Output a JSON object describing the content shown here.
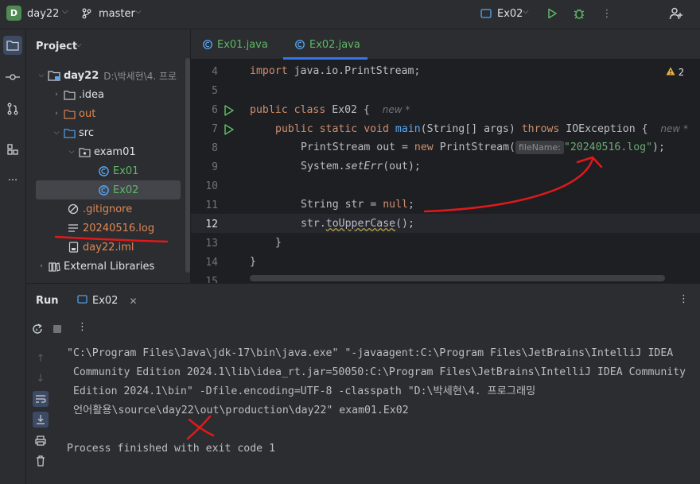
{
  "titlebar": {
    "project_badge": "D",
    "project_name": "day22",
    "branch": "master",
    "run_config": "Ex02"
  },
  "project_panel": {
    "title": "Project",
    "tree": [
      {
        "label": "day22",
        "suffix": "D:\\박세현\\4. 프로",
        "type": "module",
        "expanded": true
      },
      {
        "label": ".idea",
        "type": "folder",
        "expanded": false
      },
      {
        "label": "out",
        "type": "folder-excluded",
        "expanded": false
      },
      {
        "label": "src",
        "type": "folder-source",
        "expanded": true
      },
      {
        "label": "exam01",
        "type": "package",
        "expanded": true
      },
      {
        "label": "Ex01",
        "type": "class"
      },
      {
        "label": "Ex02",
        "type": "class",
        "selected": true
      },
      {
        "label": ".gitignore",
        "type": "ignore"
      },
      {
        "label": "20240516.log",
        "type": "text"
      },
      {
        "label": "day22.iml",
        "type": "iml"
      },
      {
        "label": "External Libraries",
        "type": "library",
        "expanded": false
      }
    ]
  },
  "editor": {
    "tabs": [
      {
        "label": "Ex01.java",
        "active": false
      },
      {
        "label": "Ex02.java",
        "active": true
      }
    ],
    "warnings": "2",
    "line_numbers": [
      "4",
      "5",
      "6",
      "7",
      "8",
      "9",
      "10",
      "11",
      "12",
      "13",
      "14",
      "15"
    ],
    "code": {
      "l4_kw": "import",
      "l4_rest": " java.io.PrintStream;",
      "l6_kw1": "public",
      "l6_kw2": "class",
      "l6_rest": " Ex02 {",
      "l6_hint": "new *",
      "l7_kw1": "public",
      "l7_kw2": "static",
      "l7_kw3": "void",
      "l7_fn": "main",
      "l7_rest1": "(String[] args) ",
      "l7_kw4": "throws",
      "l7_rest2": " IOException {",
      "l7_hint": "new *",
      "l8_a": "PrintStream out = ",
      "l8_kw": "new",
      "l8_b": " PrintStream(",
      "l8_param": "fileName:",
      "l8_str": "\"20240516.log\"",
      "l8_c": ");",
      "l9_a": "System.",
      "l9_st": "setErr",
      "l9_b": "(out);",
      "l11_a": "String str = ",
      "l11_kw": "null",
      "l11_b": ";",
      "l12_a": "str.",
      "l12_m": "toUpperCase",
      "l12_b": "();",
      "l13": "}",
      "l14": "}"
    }
  },
  "run_panel": {
    "title": "Run",
    "tab_label": "Ex02",
    "console": [
      "\"C:\\Program Files\\Java\\jdk-17\\bin\\java.exe\" \"-javaagent:C:\\Program Files\\JetBrains\\IntelliJ IDEA",
      " Community Edition 2024.1\\lib\\idea_rt.jar=50050:C:\\Program Files\\JetBrains\\IntelliJ IDEA Community",
      " Edition 2024.1\\bin\" -Dfile.encoding=UTF-8 -classpath \"D:\\박세현\\4. 프로그래밍",
      " 언어활용\\source\\day22\\out\\production\\day22\" exam01.Ex02",
      "",
      "Process finished with exit code 1"
    ]
  },
  "colors": {
    "annotation_red": "#e0191b",
    "accent": "#3574f0",
    "run_green": "#5fb865"
  }
}
